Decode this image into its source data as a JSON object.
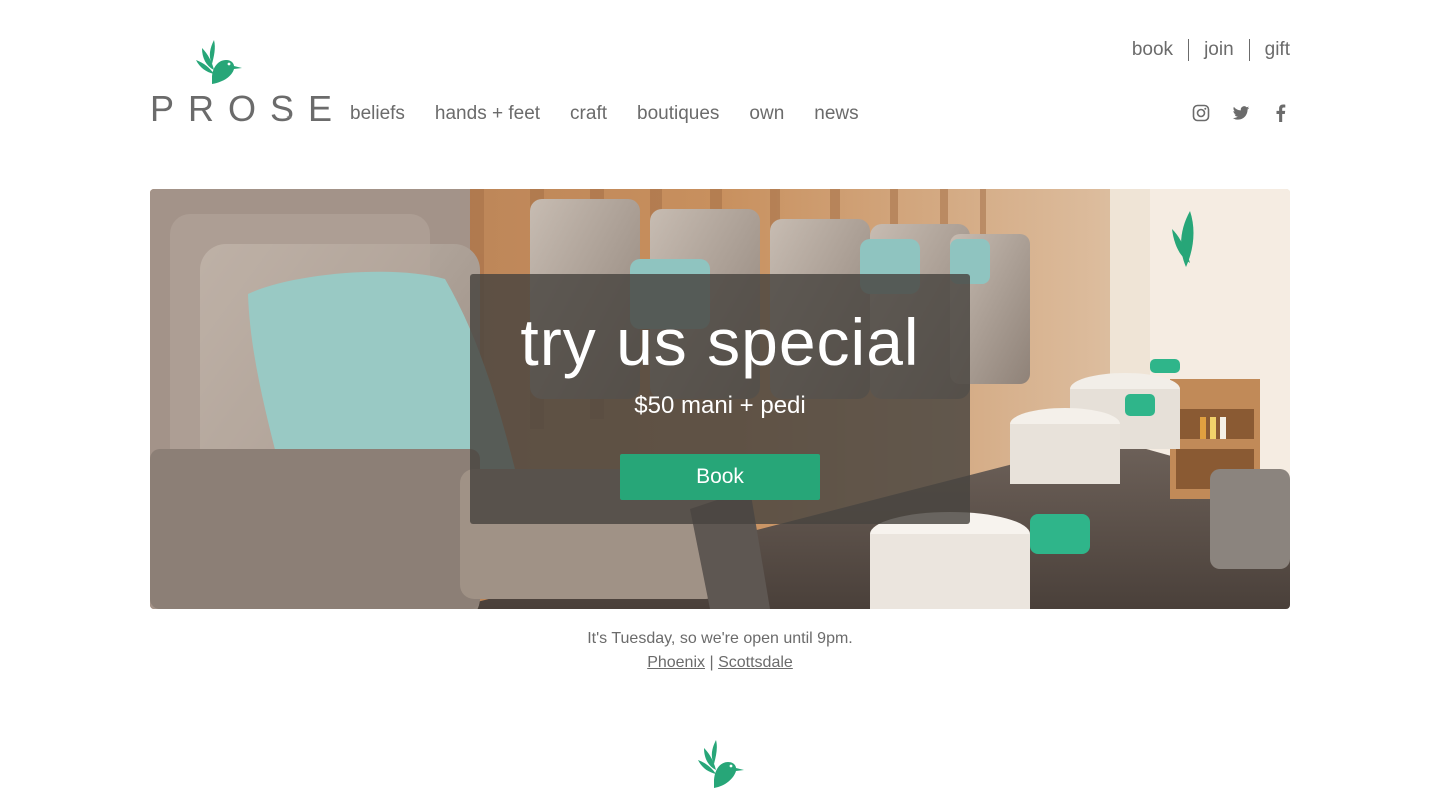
{
  "brand": {
    "name": "PROSE",
    "tm": "™",
    "accent": "#27a678",
    "text_color": "#6b6b6b"
  },
  "util_nav": [
    {
      "label": "book"
    },
    {
      "label": "join"
    },
    {
      "label": "gift"
    }
  ],
  "main_nav": [
    {
      "label": "beliefs"
    },
    {
      "label": "hands + feet"
    },
    {
      "label": "craft"
    },
    {
      "label": "boutiques"
    },
    {
      "label": "own"
    },
    {
      "label": "news"
    }
  ],
  "social": [
    "instagram-icon",
    "twitter-icon",
    "facebook-icon"
  ],
  "hero": {
    "title": "try us special",
    "subtitle": "$50 mani + pedi",
    "button_label": "Book"
  },
  "info": {
    "hours": "It's Tuesday, so we're open until 9pm.",
    "locations": [
      {
        "label": "Phoenix"
      },
      {
        "label": "Scottsdale"
      }
    ],
    "separator": "|"
  }
}
